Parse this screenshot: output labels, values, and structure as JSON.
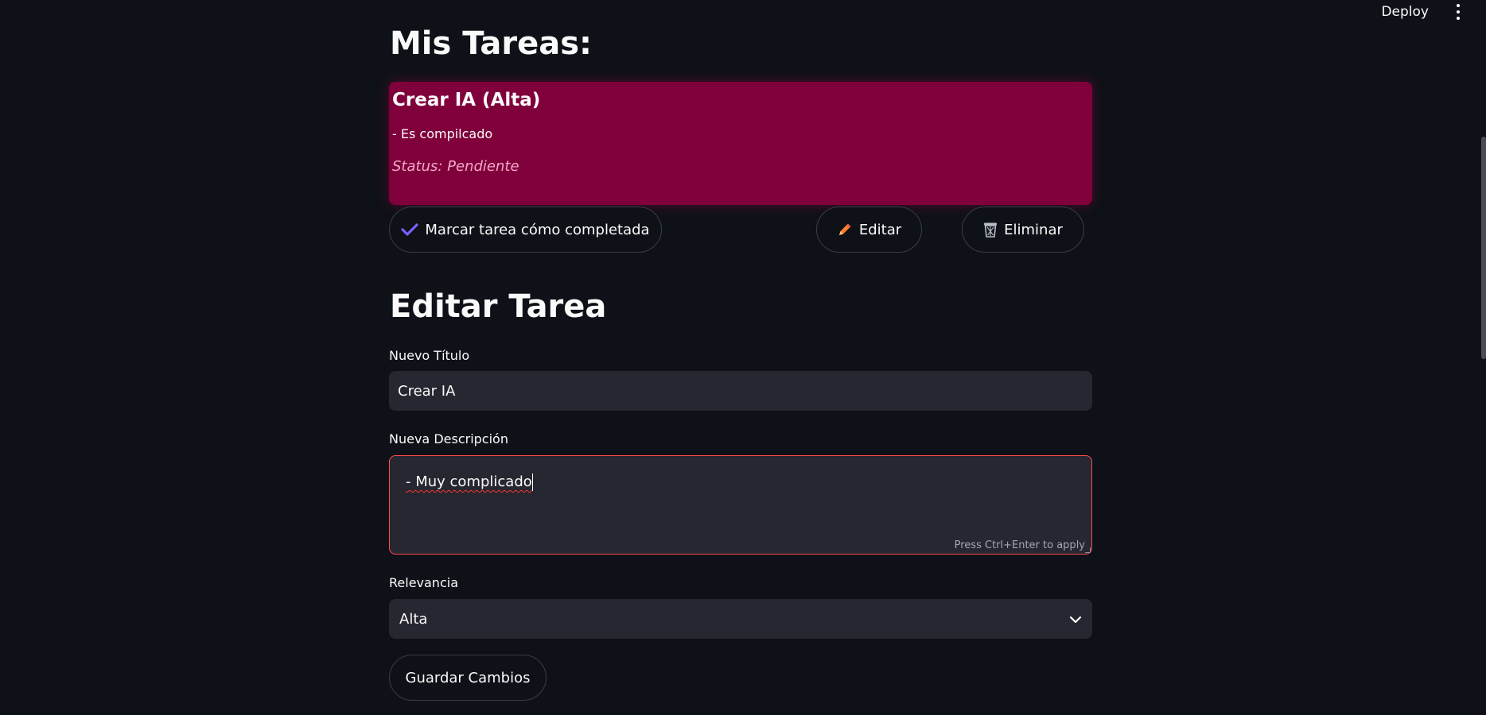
{
  "toolbar": {
    "deploy_label": "Deploy",
    "menu_icon": "vertical-ellipsis-icon"
  },
  "page_title": "Mis Tareas:",
  "task": {
    "title": "Crear IA (Alta)",
    "description": "- Es compilcado",
    "status": "Status: Pendiente",
    "card_color": "#80003c"
  },
  "actions": {
    "complete_label": "Marcar tarea cómo completada",
    "complete_icon": "check-icon",
    "edit_label": "Editar",
    "edit_icon": "pencil-icon",
    "delete_label": "Eliminar",
    "delete_icon": "wastebasket-icon"
  },
  "edit_form": {
    "heading": "Editar Tarea",
    "title_label": "Nuevo Título",
    "title_value": "Crear IA",
    "description_label": "Nueva Descripción",
    "description_value": "- Muy complicado",
    "description_hint": "Press Ctrl+Enter to apply",
    "relevance_label": "Relevancia",
    "relevance_value": "Alta",
    "save_label": "Guardar Cambios"
  },
  "colors": {
    "background": "#0e1117",
    "input_bg": "#262730",
    "focus_border": "#ff4b4b",
    "check_icon": "#7b61ff",
    "pencil_icon": "#ff7f2a"
  }
}
